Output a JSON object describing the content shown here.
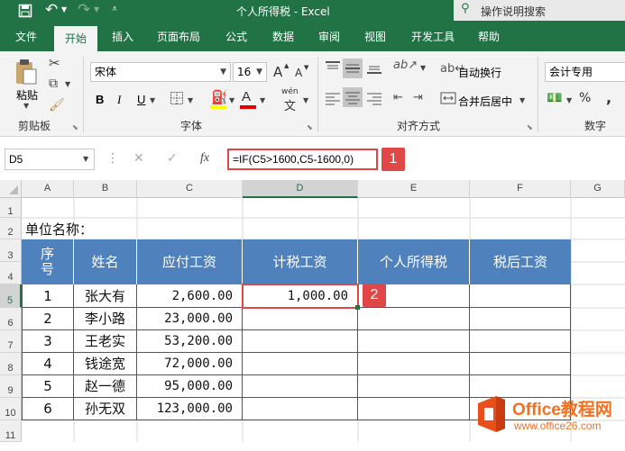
{
  "titlebar": {
    "title": "个人所得税 - Excel",
    "search_placeholder": "操作说明搜索"
  },
  "tabs": [
    "文件",
    "开始",
    "插入",
    "页面布局",
    "公式",
    "数据",
    "审阅",
    "视图",
    "开发工具",
    "帮助"
  ],
  "ribbon": {
    "paste_label": "粘贴",
    "clipboard_group": "剪贴板",
    "font_name": "宋体",
    "font_size": "16",
    "font_group": "字体",
    "wrap_text": "自动换行",
    "merge_center": "合并后居中",
    "alignment_group": "对齐方式",
    "number_format": "会计专用",
    "number_group": "数字",
    "bold": "B",
    "italic": "I",
    "underline": "U",
    "grow_font": "A",
    "shrink_font": "A",
    "wen": "wén",
    "percent": "%",
    "comma": ","
  },
  "formula_bar": {
    "name_box": "D5",
    "fx": "fx",
    "formula": "=IF(C5>1600,C5-1600,0)",
    "badge1": "1"
  },
  "sheet": {
    "columns": [
      "A",
      "B",
      "C",
      "D",
      "E",
      "F",
      "G"
    ],
    "rows": [
      "1",
      "2",
      "3",
      "4",
      "5",
      "6",
      "7",
      "8",
      "9",
      "10",
      "11"
    ],
    "unit_label": "单位名称：",
    "headers": [
      "序\n号",
      "姓名",
      "应付工资",
      "计税工资",
      "个人所得税",
      "税后工资"
    ],
    "data": [
      {
        "no": "1",
        "name": "张大有",
        "pay": "2,600.00",
        "taxable": "1,000.00"
      },
      {
        "no": "2",
        "name": "李小路",
        "pay": "23,000.00",
        "taxable": ""
      },
      {
        "no": "3",
        "name": "王老实",
        "pay": "53,200.00",
        "taxable": ""
      },
      {
        "no": "4",
        "name": "钱途宽",
        "pay": "72,000.00",
        "taxable": ""
      },
      {
        "no": "5",
        "name": "赵一德",
        "pay": "95,000.00",
        "taxable": ""
      },
      {
        "no": "6",
        "name": "孙无双",
        "pay": "123,000.00",
        "taxable": ""
      }
    ],
    "badge2": "2"
  },
  "watermark": {
    "brand": "Office教程网",
    "url": "www.office26.com"
  },
  "colors": {
    "excel_green": "#217346",
    "header_blue": "#4f81bd",
    "badge_red": "#e04848"
  }
}
